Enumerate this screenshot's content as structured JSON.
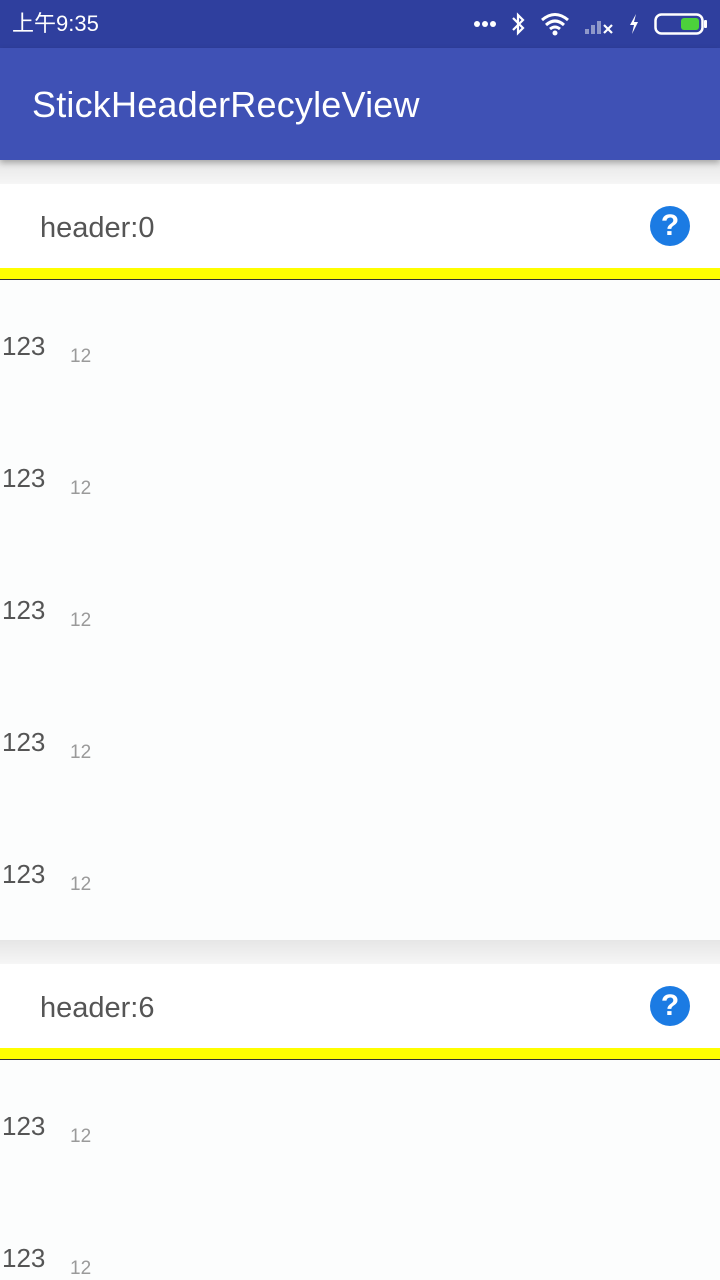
{
  "status_bar": {
    "time": "上午9:35",
    "icons": [
      "more-dots-icon",
      "bluetooth-icon",
      "wifi-icon",
      "signal-icon",
      "charging-icon",
      "battery-icon"
    ],
    "battery_color": "#4cd13b"
  },
  "app_bar": {
    "title": "StickHeaderRecyleView",
    "color": "#3f51b5"
  },
  "sections": [
    {
      "header": "header:0",
      "help_icon": "help-icon",
      "items": [
        {
          "main": "123",
          "sub": "12"
        },
        {
          "main": "123",
          "sub": "12"
        },
        {
          "main": "123",
          "sub": "12"
        },
        {
          "main": "123",
          "sub": "12"
        },
        {
          "main": "123",
          "sub": "12"
        }
      ]
    },
    {
      "header": "header:6",
      "help_icon": "help-icon",
      "items": [
        {
          "main": "123",
          "sub": "12"
        },
        {
          "main": "123",
          "sub": "12"
        }
      ]
    }
  ],
  "colors": {
    "header_underline": "#ffff00",
    "help_icon": "#1b7be3"
  }
}
